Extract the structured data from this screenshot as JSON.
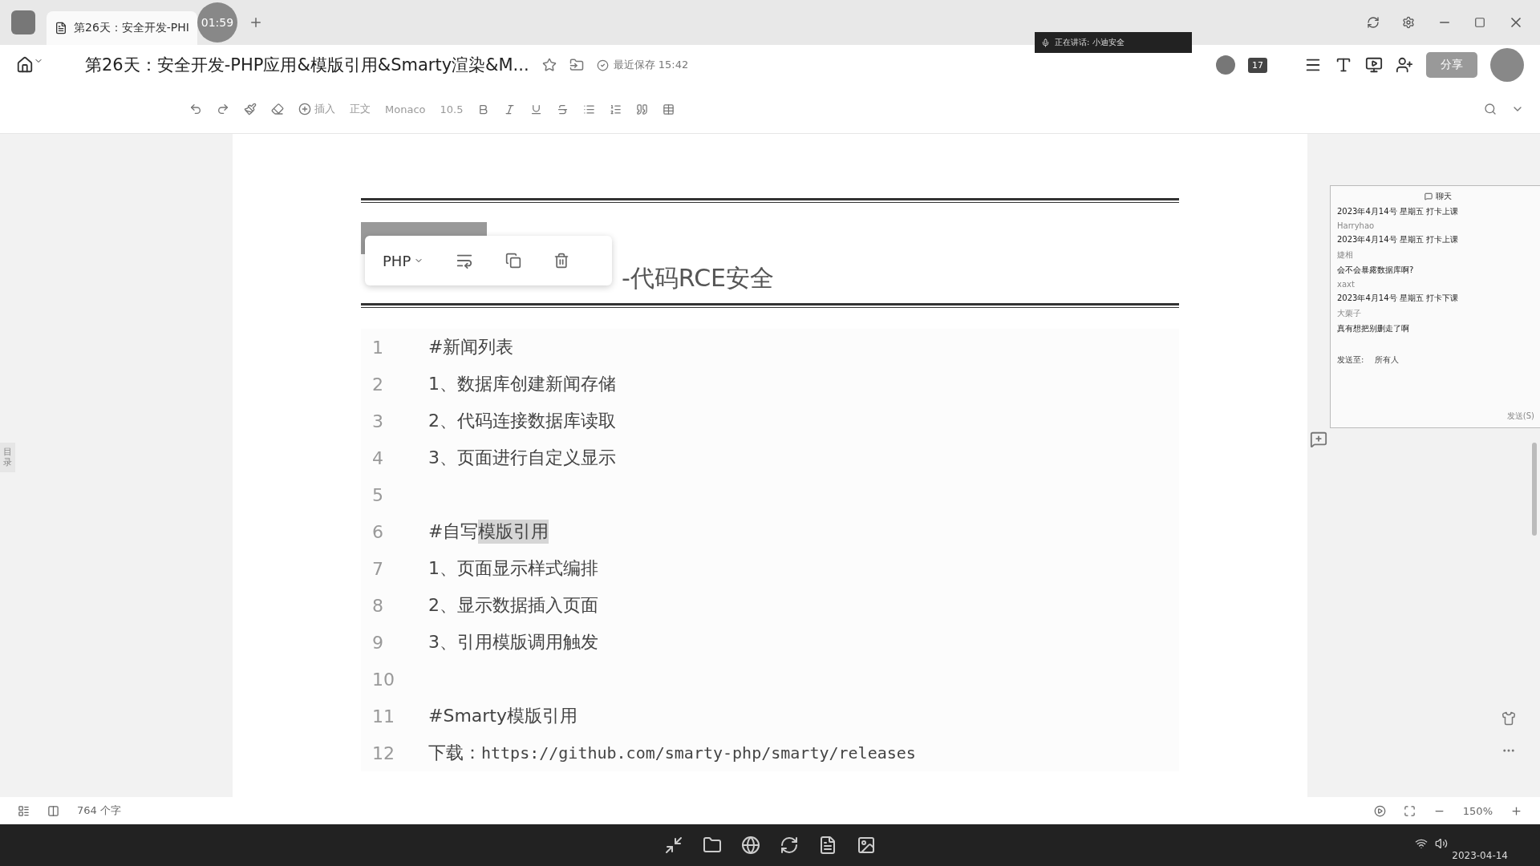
{
  "tab": {
    "title": "第26天：安全开发-PHI",
    "timer": "01:59"
  },
  "doc": {
    "title": "第26天：安全开发-PHP应用&模版引用&Smarty渲染&M...",
    "saved": "最近保存 15:42",
    "speaker": "正在讲话: 小迪安全",
    "avatar_count": "17",
    "share": "分享"
  },
  "toolbar": {
    "insert": "插入",
    "style": "正文",
    "font": "Monaco",
    "size": "10.5"
  },
  "side_label": "目录",
  "heading": "-代码RCE安全",
  "code_popup": {
    "language": "PHP"
  },
  "code_lines": [
    {
      "number": "1",
      "segments": [
        {
          "text": "#新闻列表",
          "highlighted": false,
          "kind": "text"
        }
      ]
    },
    {
      "number": "2",
      "segments": [
        {
          "text": "1、数据库创建新闻存储",
          "highlighted": false,
          "kind": "text"
        }
      ]
    },
    {
      "number": "3",
      "segments": [
        {
          "text": "2、代码连接数据库读取",
          "highlighted": false,
          "kind": "text"
        }
      ]
    },
    {
      "number": "4",
      "segments": [
        {
          "text": "3、页面进行自定义显示",
          "highlighted": false,
          "kind": "text"
        }
      ]
    },
    {
      "number": "5"
    },
    {
      "number": "6",
      "segments": [
        {
          "text": "#自写",
          "highlighted": false,
          "kind": "text"
        },
        {
          "text": "模版引用",
          "highlighted": true,
          "kind": "text"
        }
      ]
    },
    {
      "number": "7",
      "segments": [
        {
          "text": "1、页面显示样式编排",
          "highlighted": false,
          "kind": "text"
        }
      ]
    },
    {
      "number": "8",
      "segments": [
        {
          "text": "2、显示数据插入页面",
          "highlighted": false,
          "kind": "text"
        }
      ]
    },
    {
      "number": "9",
      "segments": [
        {
          "text": "3、引用模版调用触发",
          "highlighted": false,
          "kind": "text"
        }
      ]
    },
    {
      "number": "10"
    },
    {
      "number": "11",
      "segments": [
        {
          "text": "#Smarty模版引用",
          "highlighted": false,
          "kind": "text"
        }
      ]
    },
    {
      "number": "12",
      "segments": [
        {
          "text": "下载：",
          "highlighted": false,
          "kind": "text"
        },
        {
          "text": "https://github.com/smarty-php/smarty/releases",
          "highlighted": false,
          "kind": "url"
        }
      ]
    }
  ],
  "chat": {
    "title": "聊天",
    "messages": [
      {
        "text": "2023年4月14号 星期五 打卡上课"
      },
      {
        "name": "Harryhao",
        "text": "2023年4月14号 星期五 打卡上课"
      },
      {
        "name": "婕相",
        "text": "会不会暴露数据库啊?"
      },
      {
        "name": "xaxt",
        "text": "2023年4月14号 星期五 打卡下课"
      },
      {
        "name": "大栗子",
        "text": "真有想把别删走了啊"
      }
    ],
    "send_to_label": "发送至:",
    "send_to": "所有人",
    "send": "发送(S)"
  },
  "status_bar": {
    "word_count": "764 个字",
    "zoom": "150%"
  },
  "taskbar": {
    "date": "2023-04-14"
  }
}
